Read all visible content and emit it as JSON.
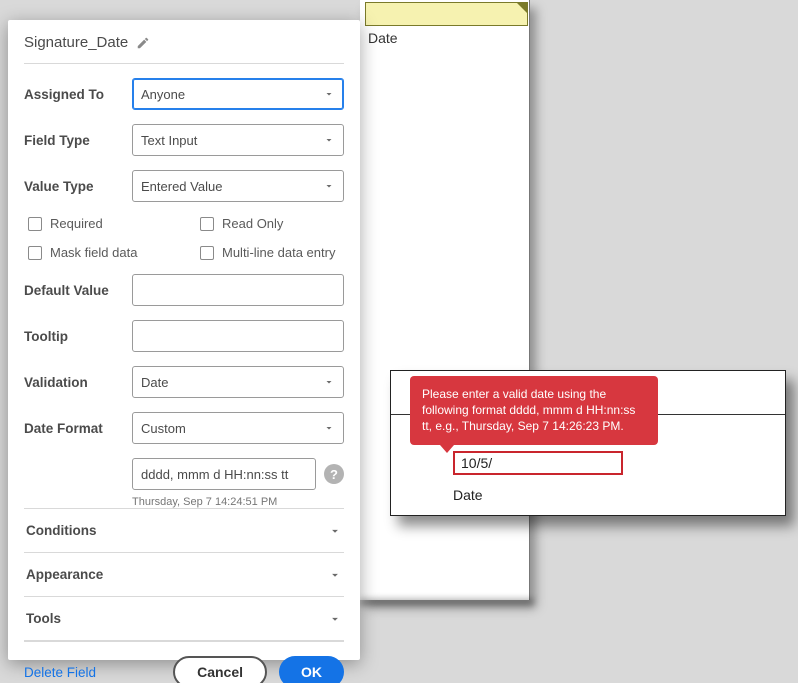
{
  "doc_field_label": "Date",
  "panel": {
    "title": "Signature_Date",
    "labels": {
      "assigned_to": "Assigned To",
      "field_type": "Field Type",
      "value_type": "Value Type",
      "default_value": "Default Value",
      "tooltip": "Tooltip",
      "validation": "Validation",
      "date_format": "Date Format"
    },
    "values": {
      "assigned_to": "Anyone",
      "field_type": "Text Input",
      "value_type": "Entered Value",
      "default_value": "",
      "tooltip": "",
      "validation": "Date",
      "date_format": "Custom",
      "format_string": "dddd, mmm d  HH:nn:ss tt"
    },
    "format_preview": "Thursday, Sep 7 14:24:51 PM",
    "checks": {
      "required": "Required",
      "read_only": "Read Only",
      "mask": "Mask field data",
      "multiline": "Multi-line data entry"
    },
    "accordions": {
      "conditions": "Conditions",
      "appearance": "Appearance",
      "tools": "Tools"
    },
    "footer": {
      "delete": "Delete Field",
      "cancel": "Cancel",
      "ok": "OK"
    }
  },
  "tooltip_text": "Please enter a valid date using the following format dddd, mmm d HH:nn:ss tt, e.g., Thursday, Sep 7 14:26:23 PM.",
  "val_input_value": "10/5/",
  "val_field_label": "Date"
}
